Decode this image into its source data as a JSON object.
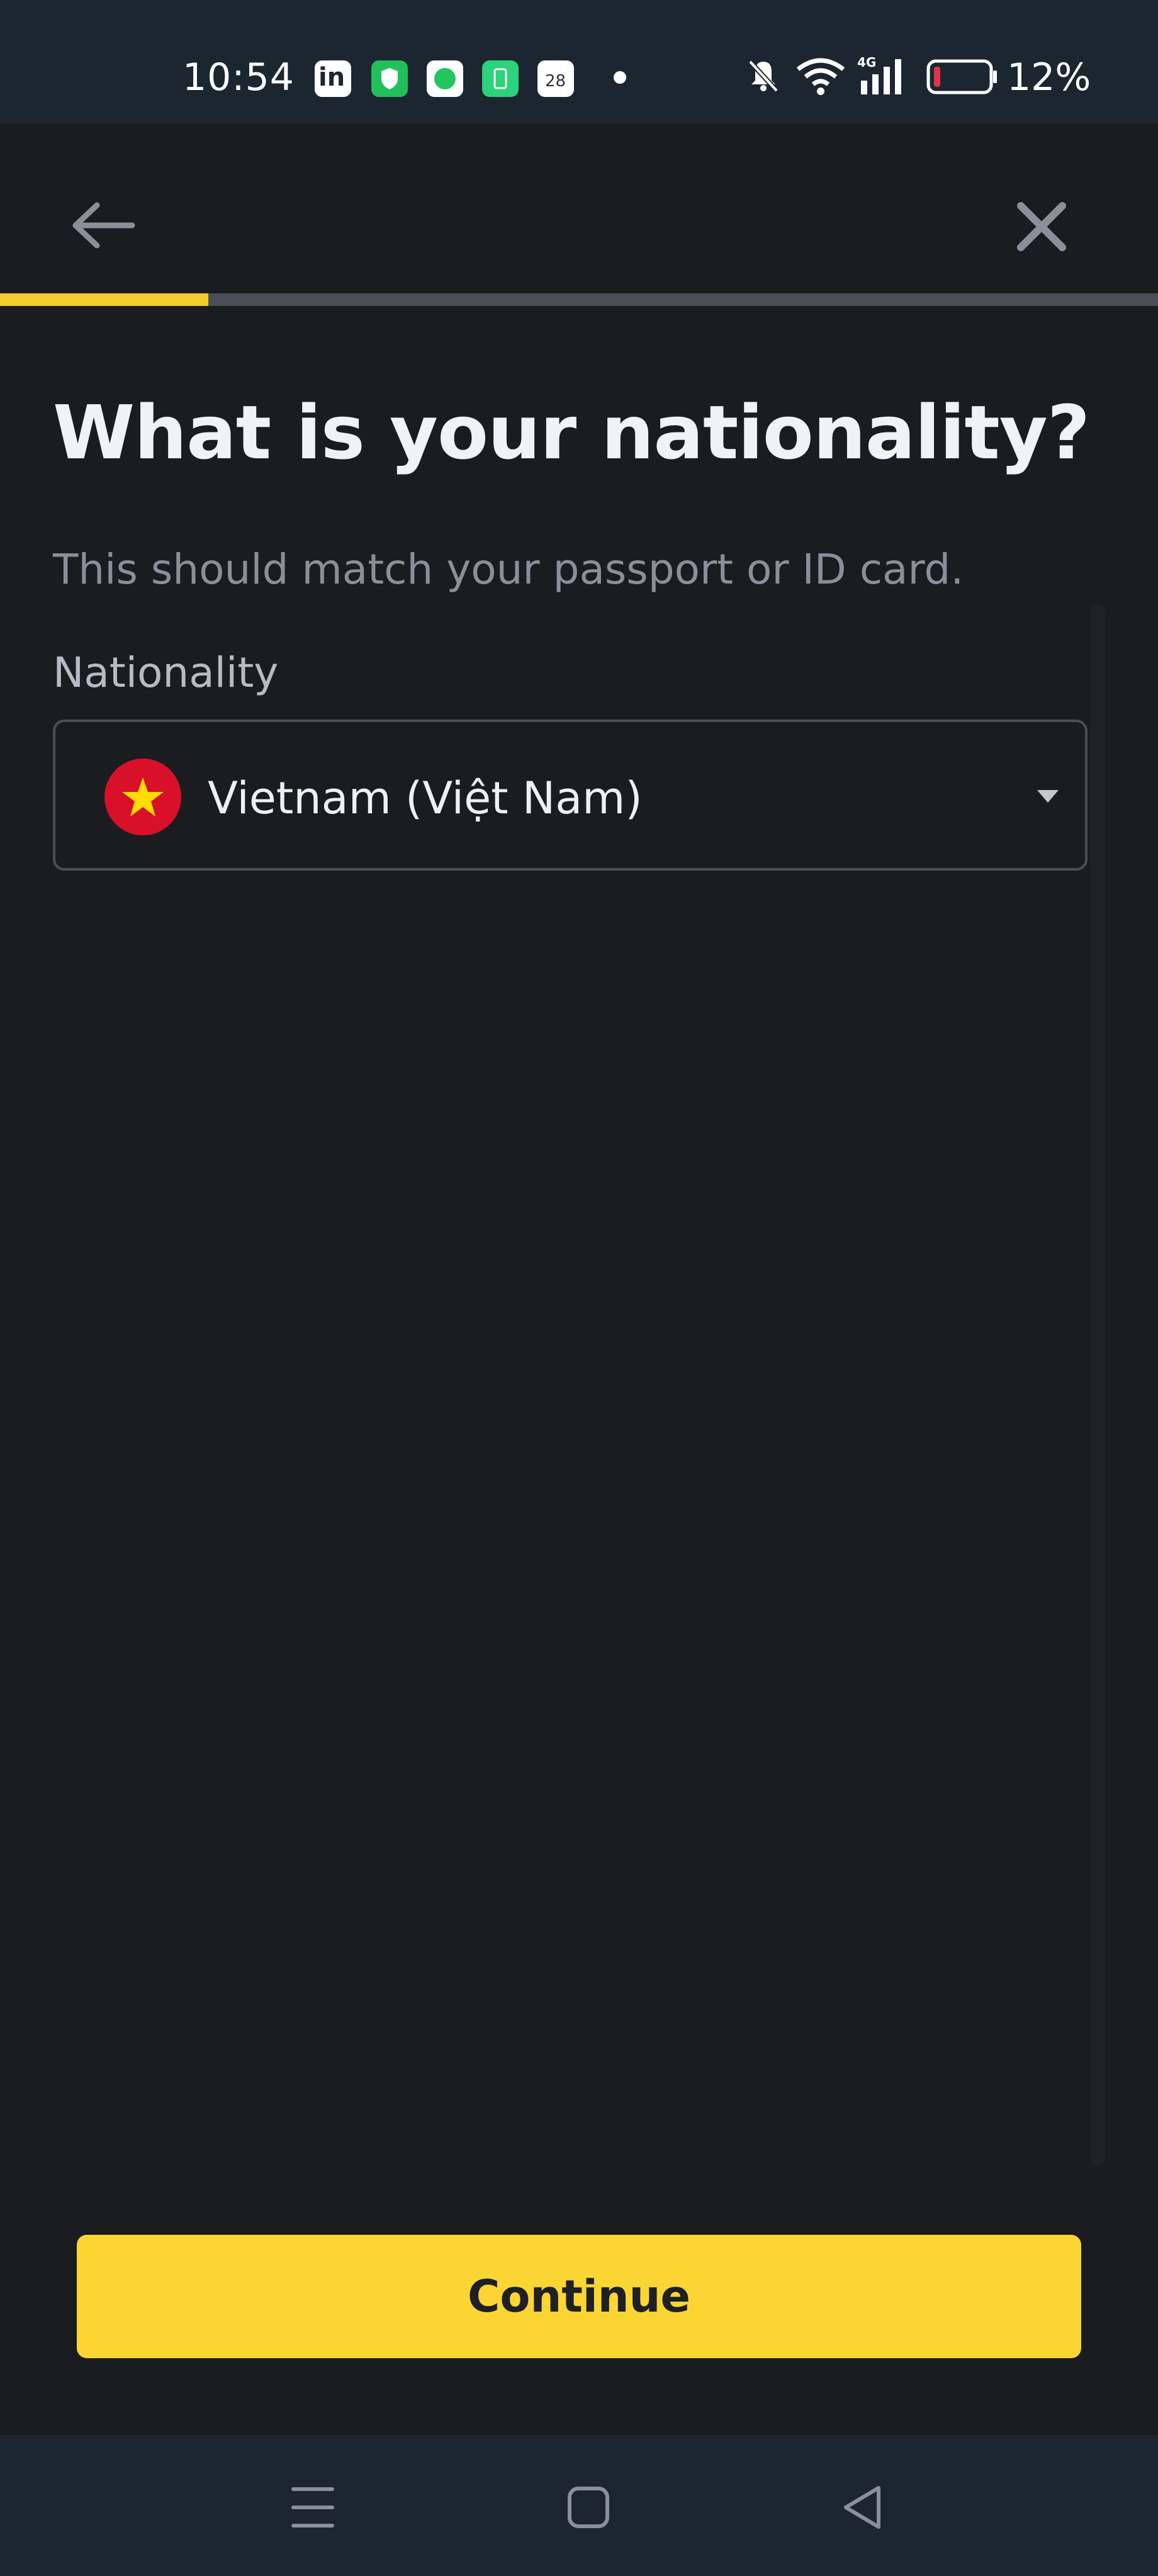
{
  "status_bar": {
    "time": "10:54",
    "battery_percent": "12%",
    "battery_level": 0.12,
    "network_label": "4G",
    "calendar_day": "28"
  },
  "header": {
    "progress_fraction": 0.18
  },
  "main": {
    "title": "What is your nationality?",
    "subtitle": "This should match your passport or ID card.",
    "field_label": "Nationality",
    "selected_value": "Vietnam (Việt Nam)"
  },
  "footer": {
    "continue_label": "Continue"
  },
  "colors": {
    "accent": "#fbd534",
    "progress": "#f3cc2e",
    "background": "#1b1c20",
    "flag_red": "#d9102a",
    "flag_star": "#ffdd00"
  },
  "icons": {
    "back": "arrow-left-icon",
    "close": "close-icon",
    "caret": "caret-down-icon",
    "flag": "vietnam-flag-icon"
  }
}
